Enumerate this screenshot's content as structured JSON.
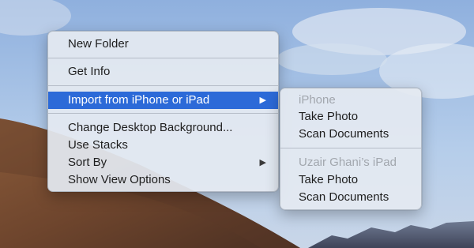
{
  "context_menu": {
    "items": [
      {
        "label": "New Folder"
      },
      {
        "label": "Get Info"
      },
      {
        "label": "Import from iPhone or iPad",
        "highlighted": true,
        "has_submenu": true
      },
      {
        "label": "Change Desktop Background..."
      },
      {
        "label": "Use Stacks"
      },
      {
        "label": "Sort By",
        "has_submenu": true
      },
      {
        "label": "Show View Options"
      }
    ],
    "submenu_arrow": "▶"
  },
  "submenu": {
    "groups": [
      {
        "device": "iPhone",
        "actions": [
          "Take Photo",
          "Scan Documents"
        ]
      },
      {
        "device": "Uzair Ghani’s iPad",
        "actions": [
          "Take Photo",
          "Scan Documents"
        ]
      }
    ]
  },
  "colors": {
    "highlight": "#2c6ad8",
    "menu_background": "#e4e9f1",
    "disabled_text": "#a2a7ae",
    "sky": "#9fbde6",
    "dune": "#7a4f33"
  }
}
